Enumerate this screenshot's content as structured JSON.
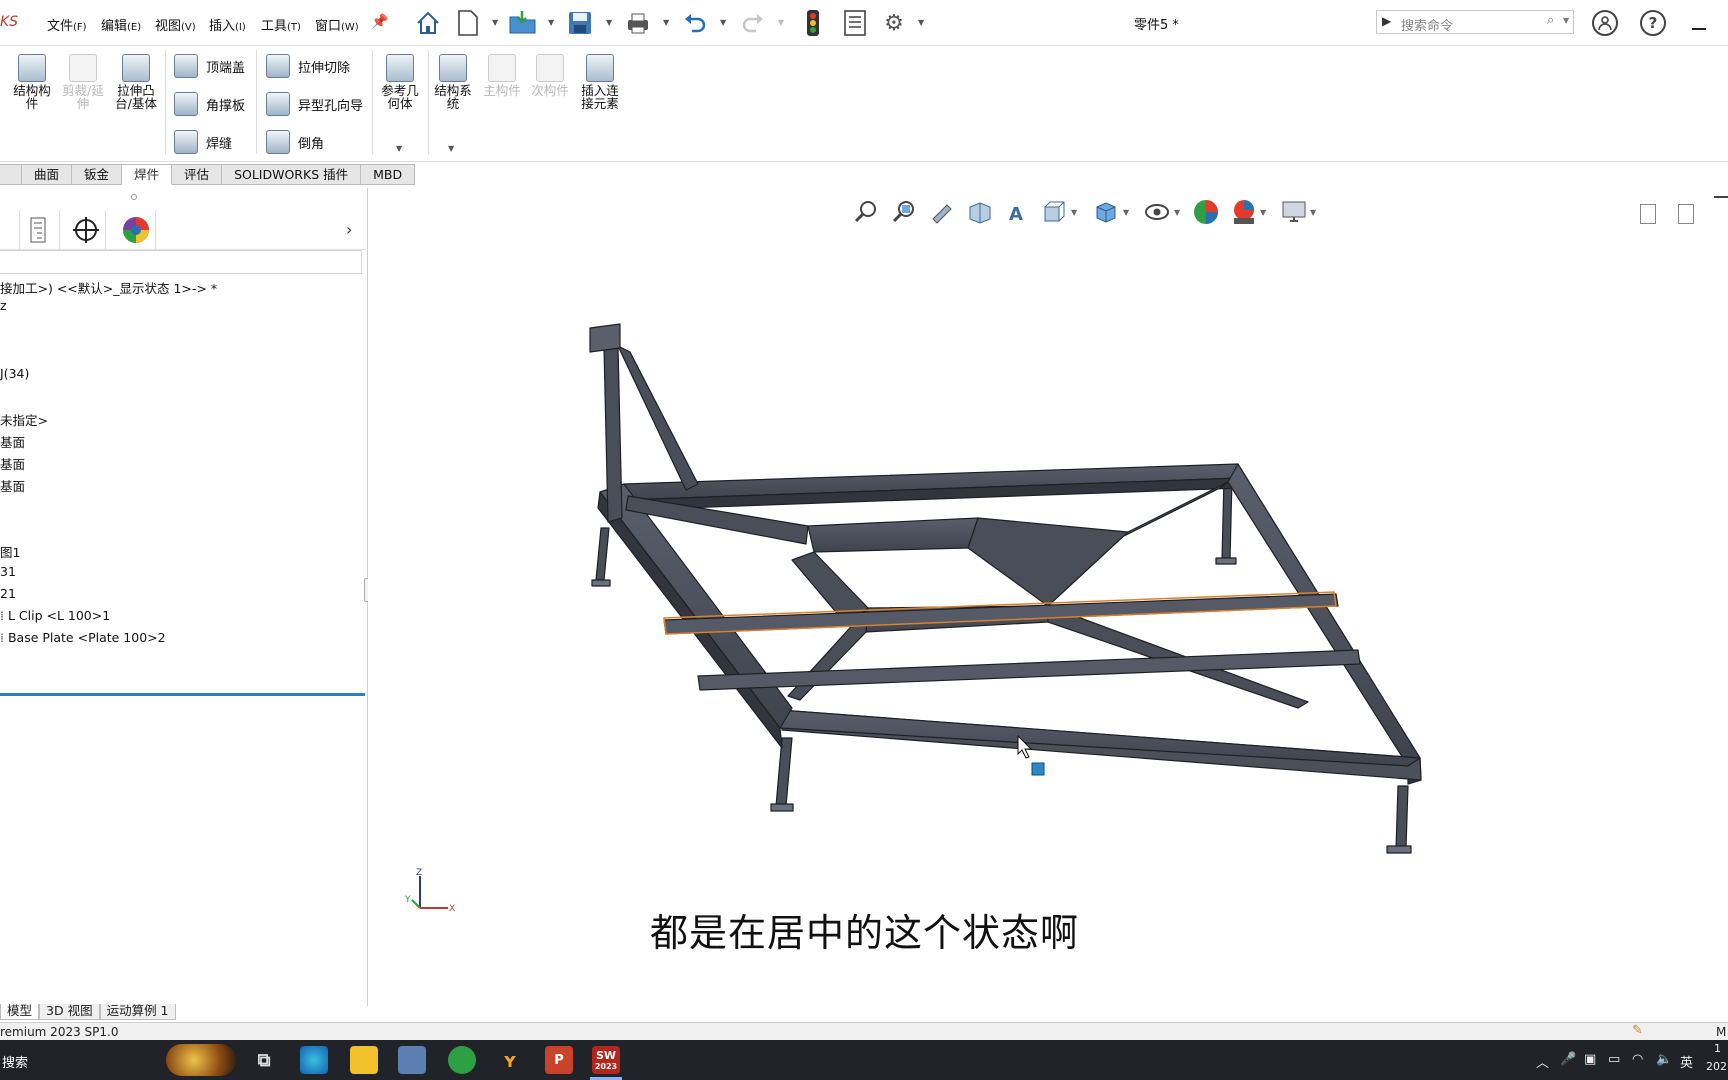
{
  "app": {
    "brand": "KS",
    "doc_title": "零件5 *",
    "menus": [
      {
        "label": "文件",
        "key": "(F)"
      },
      {
        "label": "编辑",
        "key": "(E)"
      },
      {
        "label": "视图",
        "key": "(V)"
      },
      {
        "label": "插入",
        "key": "(I)"
      },
      {
        "label": "工具",
        "key": "(T)"
      },
      {
        "label": "窗口",
        "key": "(W)"
      }
    ],
    "search_placeholder": "搜索命令"
  },
  "ribbon": {
    "structure_member": "结构构件",
    "trim_extend": "剪裁/延伸",
    "extrude_boss": "拉伸凸台/基体",
    "end_cap": "顶端盖",
    "gusset": "角撑板",
    "weld_bead": "焊缝",
    "extrude_cut": "拉伸切除",
    "hole_wizard": "异型孔向导",
    "chamfer": "倒角",
    "ref_geometry": "参考几何体",
    "struct_system": "结构系统",
    "primary_member": "主构件",
    "secondary_member": "次构件",
    "insert_connection": "插入连接元素"
  },
  "tabs": [
    "曲面",
    "钣金",
    "焊件",
    "评估",
    "SOLIDWORKS 插件",
    "MBD"
  ],
  "active_tab": "焊件",
  "tree": [
    "接加工>) <<默认>_显示状态 1>-> *",
    "z",
    "J(34)",
    "未指定>",
    "基面",
    "基面",
    "基面",
    "图1",
    "31",
    "21",
    "L Clip <L 100>1",
    "Base Plate <Plate 100>2"
  ],
  "subtitle": "都是在居中的这个状态啊",
  "bottom_tabs": [
    "模型",
    "3D 视图",
    "运动算例 1"
  ],
  "status_text": "remium 2023 SP1.0",
  "status_right": "M",
  "taskbar": {
    "search": "搜索",
    "sw_label": "2023",
    "ime": "英",
    "clock_top": "1",
    "clock_bottom": "202"
  }
}
